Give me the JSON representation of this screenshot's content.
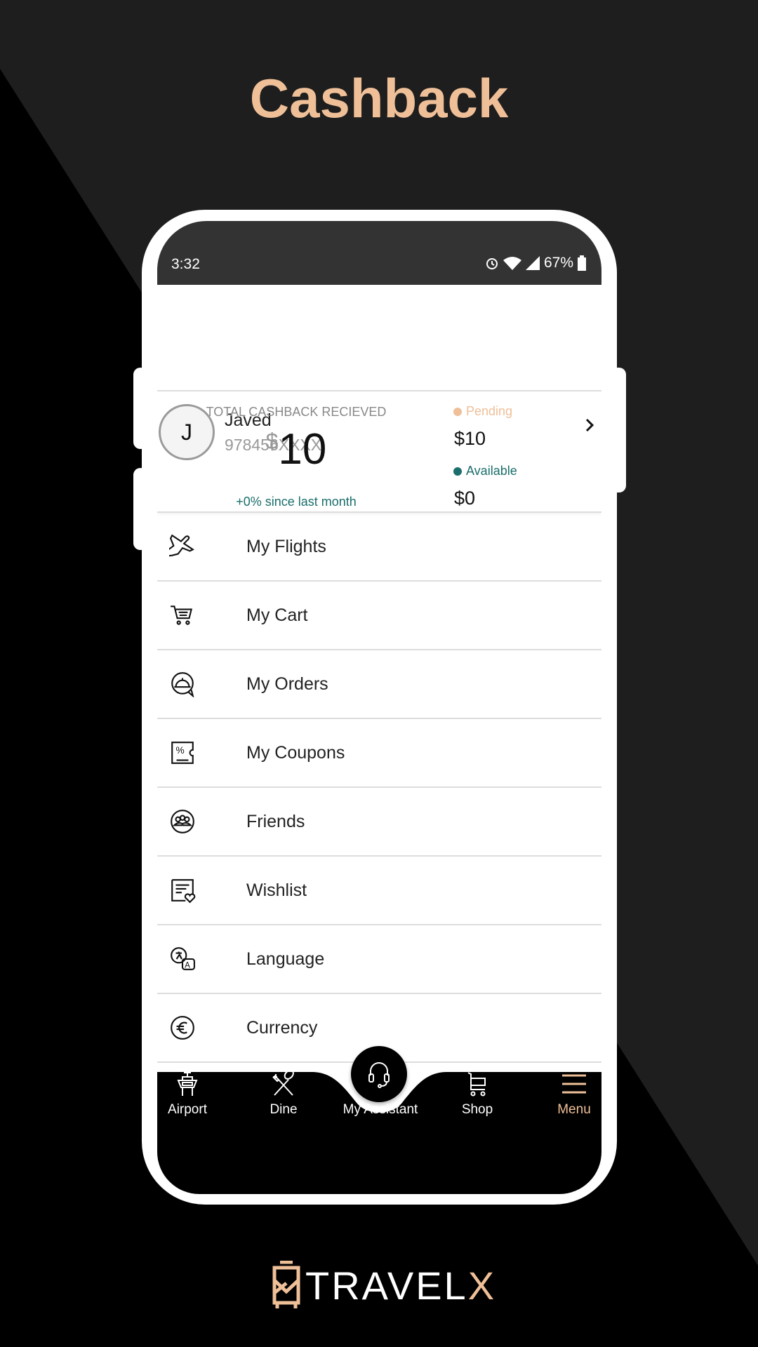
{
  "page_title": "Cashback",
  "colors": {
    "accent": "#efbf98",
    "teal": "#1a6e6b",
    "background": "#1e1e1e"
  },
  "status_bar": {
    "time": "3:32",
    "battery": "67%",
    "icons": [
      "alarm-icon",
      "wifi-icon",
      "signal-icon",
      "battery-icon"
    ]
  },
  "profile": {
    "initial": "J",
    "name": "Javed",
    "phone": "978456XXXX"
  },
  "cashback": {
    "label": "TOTAL CASHBACK RECIEVED",
    "currency": "$",
    "amount": "10",
    "change": "+0% since last month",
    "pending_label": "Pending",
    "pending_value": "$10",
    "available_label": "Available",
    "available_value": "$0"
  },
  "menu": [
    {
      "label": "My Flights",
      "icon": "airplane-icon"
    },
    {
      "label": "My Cart",
      "icon": "cart-icon"
    },
    {
      "label": "My Orders",
      "icon": "cloche-icon"
    },
    {
      "label": "My Coupons",
      "icon": "coupon-icon"
    },
    {
      "label": "Friends",
      "icon": "friends-icon"
    },
    {
      "label": "Wishlist",
      "icon": "wishlist-icon"
    },
    {
      "label": "Language",
      "icon": "language-icon"
    },
    {
      "label": "Currency",
      "icon": "euro-icon"
    }
  ],
  "nav": [
    {
      "label": "Airport",
      "icon": "control-tower-icon"
    },
    {
      "label": "Dine",
      "icon": "fork-spoon-icon"
    },
    {
      "label": "My Assistant",
      "icon": "headset-icon"
    },
    {
      "label": "Shop",
      "icon": "cart-icon"
    },
    {
      "label": "Menu",
      "icon": "hamburger-icon",
      "active": true
    }
  ],
  "brand": {
    "logo_text": "TRAVEL",
    "logo_text_accent": "X"
  }
}
